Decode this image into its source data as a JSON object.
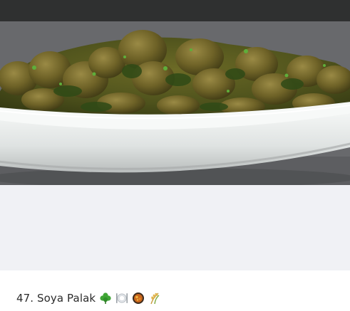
{
  "post": {
    "image": {
      "dish": "soya-palak-curry-photo"
    },
    "caption": {
      "text": "47. Soya Palak",
      "emojis": [
        "shamrock-icon",
        "plate-icon",
        "curry-bowl-icon",
        "rice-stalk-icon"
      ]
    }
  }
}
